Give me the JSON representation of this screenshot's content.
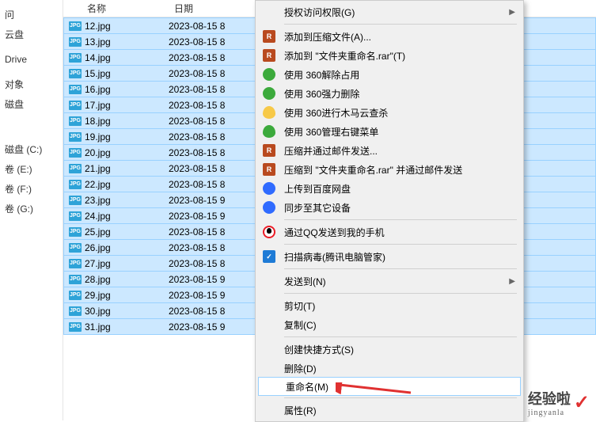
{
  "header": {
    "name": "名称",
    "date": "日期"
  },
  "sidebar": {
    "items": [
      {
        "label": "问"
      },
      {
        "label": "云盘"
      },
      {
        "label": ""
      },
      {
        "label": "Drive"
      },
      {
        "label": ""
      },
      {
        "label": "对象"
      },
      {
        "label": "磁盘"
      },
      {
        "label": ""
      },
      {
        "label": ""
      },
      {
        "label": ""
      },
      {
        "label": ""
      },
      {
        "label": "磁盘 (C:)"
      },
      {
        "label": "卷 (E:)"
      },
      {
        "label": "卷 (F:)"
      },
      {
        "label": "卷 (G:)"
      }
    ]
  },
  "files": [
    {
      "name": "12.jpg",
      "date": "2023-08-15 8"
    },
    {
      "name": "13.jpg",
      "date": "2023-08-15 8"
    },
    {
      "name": "14.jpg",
      "date": "2023-08-15 8"
    },
    {
      "name": "15.jpg",
      "date": "2023-08-15 8"
    },
    {
      "name": "16.jpg",
      "date": "2023-08-15 8"
    },
    {
      "name": "17.jpg",
      "date": "2023-08-15 8"
    },
    {
      "name": "18.jpg",
      "date": "2023-08-15 8"
    },
    {
      "name": "19.jpg",
      "date": "2023-08-15 8"
    },
    {
      "name": "20.jpg",
      "date": "2023-08-15 8"
    },
    {
      "name": "21.jpg",
      "date": "2023-08-15 8"
    },
    {
      "name": "22.jpg",
      "date": "2023-08-15 8"
    },
    {
      "name": "23.jpg",
      "date": "2023-08-15 9"
    },
    {
      "name": "24.jpg",
      "date": "2023-08-15 9"
    },
    {
      "name": "25.jpg",
      "date": "2023-08-15 8"
    },
    {
      "name": "26.jpg",
      "date": "2023-08-15 8"
    },
    {
      "name": "27.jpg",
      "date": "2023-08-15 8"
    },
    {
      "name": "28.jpg",
      "date": "2023-08-15 9"
    },
    {
      "name": "29.jpg",
      "date": "2023-08-15 9"
    },
    {
      "name": "30.jpg",
      "date": "2023-08-15 8"
    },
    {
      "name": "31.jpg",
      "date": "2023-08-15 9"
    }
  ],
  "menu": {
    "grant": "授权访问权限(G)",
    "addarchive": "添加到压缩文件(A)...",
    "addto": "添加到 \"文件夹重命名.rar\"(T)",
    "use360unlock": "使用 360解除占用",
    "use360del": "使用 360强力删除",
    "use360trojan": "使用 360进行木马云查杀",
    "use360context": "使用 360管理右键菜单",
    "archmail": "压缩并通过邮件发送...",
    "archtomail": "压缩到 \"文件夹重命名.rar\" 并通过邮件发送",
    "baidu": "上传到百度网盘",
    "sync": "同步至其它设备",
    "qq": "通过QQ发送到我的手机",
    "scan": "扫描病毒(腾讯电脑管家)",
    "sendto": "发送到(N)",
    "cut": "剪切(T)",
    "copy": "复制(C)",
    "shortcut": "创建快捷方式(S)",
    "delete": "删除(D)",
    "rename": "重命名(M)",
    "properties": "属性(R)"
  },
  "watermark": {
    "text": "经验啦",
    "sub": "jingyanla"
  }
}
